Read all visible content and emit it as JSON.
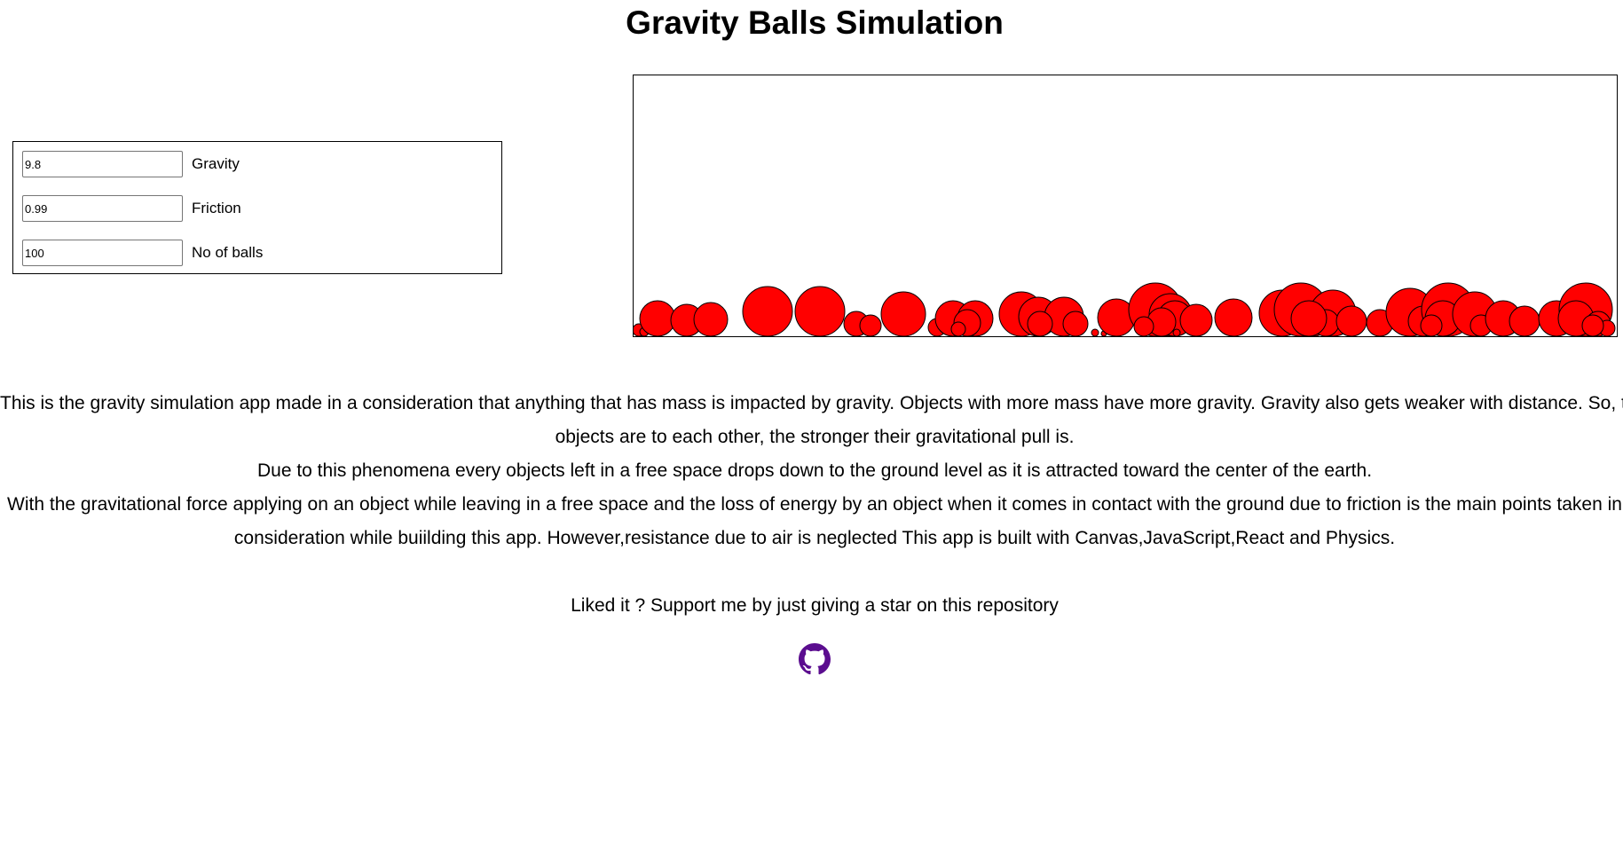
{
  "page": {
    "title": "Gravity Balls Simulation"
  },
  "controls": {
    "gravity": {
      "value": "9.8",
      "label": "Gravity"
    },
    "friction": {
      "value": "0.99",
      "label": "Friction"
    },
    "balls": {
      "value": "100",
      "label": "No of balls"
    }
  },
  "simulation": {
    "ball_color": "#ff0000",
    "ball_stroke": "#000000"
  },
  "description": {
    "line1": "This is the gravity simulation app made in a consideration that anything that has mass is impacted by gravity. Objects with more mass have more gravity. Gravity also gets weaker with distance. So, the closer",
    "line2": "objects are to each other, the stronger their gravitational pull is.",
    "line3": "Due to this phenomena every objects left in a free space drops down to the ground level as it is attracted toward the center of the earth.",
    "line4": "With the gravitational force applying on an object while leaving in a free space and the loss of energy by an object when it comes in contact with the ground due to friction is the main points taken in",
    "line5": "consideration while buiilding this app. However,resistance due to air is neglected This app is built with Canvas,JavaScript,React and Physics."
  },
  "support": {
    "text": "Liked it ? Support me by just giving a star on this repository",
    "icon": "github-icon",
    "icon_color": "#5b0d8f"
  }
}
